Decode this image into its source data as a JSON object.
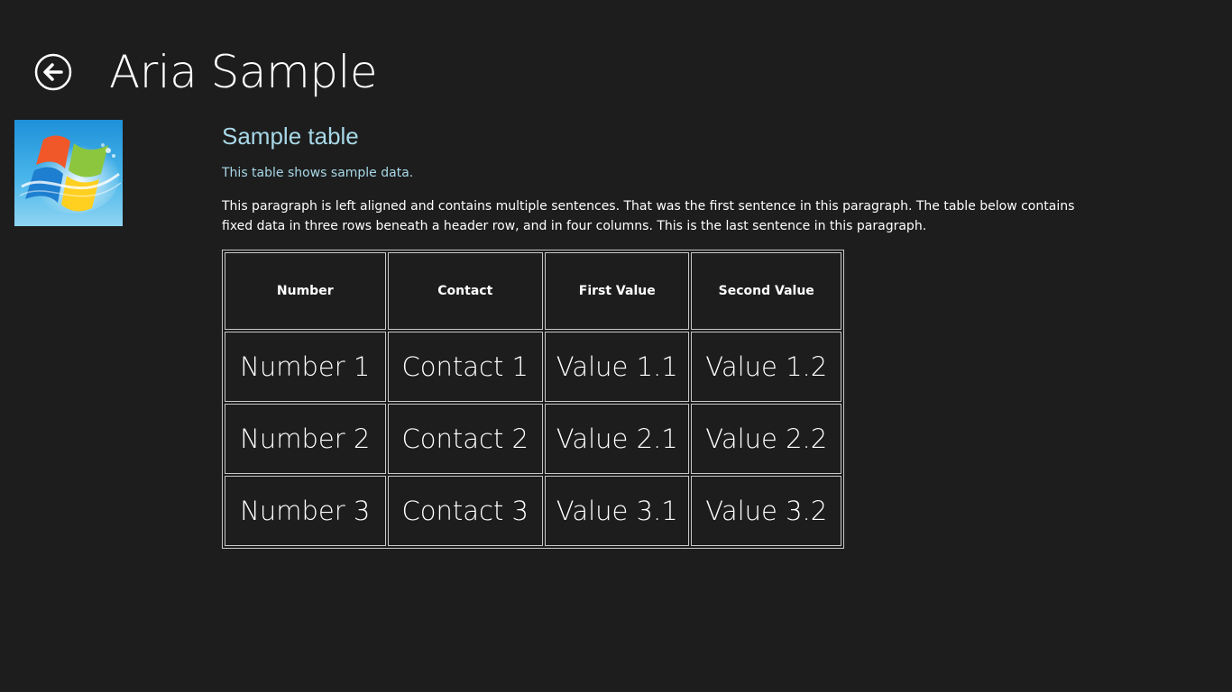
{
  "header": {
    "title": "Aria Sample",
    "back_icon": "back-arrow-circle-icon"
  },
  "logo": {
    "icon": "windows-logo-icon",
    "colors": {
      "sky_top": "#1e90d8",
      "sky_bottom": "#8fd4f2",
      "flag_red": "#f0582a",
      "flag_green": "#8cc63f",
      "flag_blue": "#1e7fd0",
      "flag_yellow": "#ffd01f"
    }
  },
  "main": {
    "section_title": "Sample table",
    "description": "This table shows sample data.",
    "paragraph": "This paragraph is left aligned and contains multiple sentences. That was the first sentence in this paragraph. The table below contains fixed data in three rows beneath a header row, and in four columns. This is the last sentence in this paragraph."
  },
  "table": {
    "headers": [
      "Number",
      "Contact",
      "First Value",
      "Second Value"
    ],
    "rows": [
      [
        "Number 1",
        "Contact 1",
        "Value 1.1",
        "Value 1.2"
      ],
      [
        "Number 2",
        "Contact 2",
        "Value 2.1",
        "Value 2.2"
      ],
      [
        "Number 3",
        "Contact 3",
        "Value 3.1",
        "Value 3.2"
      ]
    ]
  },
  "colors": {
    "background": "#1d1d1d",
    "accent_text": "#a8d8e8",
    "text": "#ffffff",
    "table_border": "#c8c8c8"
  }
}
